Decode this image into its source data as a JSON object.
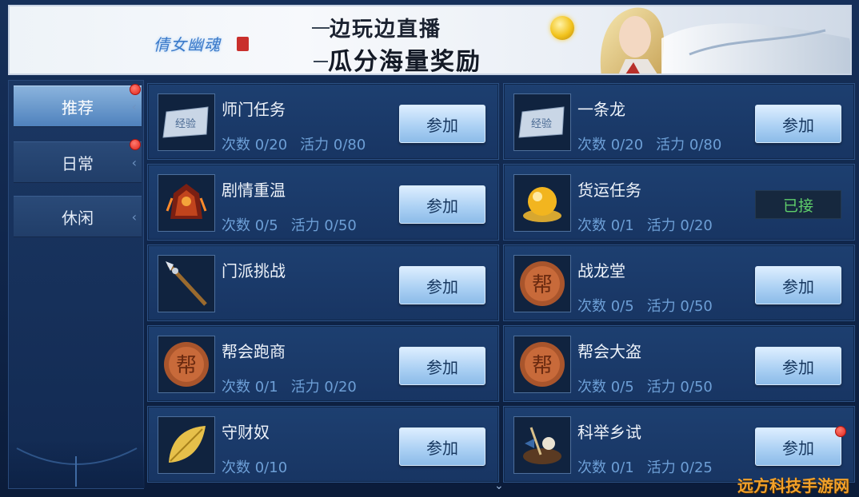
{
  "banner": {
    "logo": "倩女幽魂",
    "logo_sub": "手游",
    "title": "边玩边直播",
    "subtitle": "瓜分海量奖励"
  },
  "sidebar": {
    "tabs": [
      {
        "label": "推荐",
        "active": true,
        "badge": true
      },
      {
        "label": "日常",
        "active": false,
        "badge": true
      },
      {
        "label": "休闲",
        "active": false,
        "badge": false
      }
    ]
  },
  "activities": [
    {
      "name": "师门任务",
      "count": "次数 0/20",
      "vitality": "活力 0/80",
      "action": "参加",
      "icon": "exp-scroll-icon"
    },
    {
      "name": "一条龙",
      "count": "次数 0/20",
      "vitality": "活力 0/80",
      "action": "参加",
      "icon": "exp-scroll-icon"
    },
    {
      "name": "剧情重温",
      "count": "次数 0/5",
      "vitality": "活力 0/50",
      "action": "参加",
      "icon": "flame-helmet-icon"
    },
    {
      "name": "货运任务",
      "count": "次数 0/1",
      "vitality": "活力 0/20",
      "action": "已接",
      "icon": "golden-orb-icon"
    },
    {
      "name": "门派挑战",
      "count": "",
      "vitality": "",
      "action": "参加",
      "icon": "spear-icon"
    },
    {
      "name": "战龙堂",
      "count": "次数 0/5",
      "vitality": "活力 0/50",
      "action": "参加",
      "icon": "guild-coin-icon"
    },
    {
      "name": "帮会跑商",
      "count": "次数 0/1",
      "vitality": "活力 0/20",
      "action": "参加",
      "icon": "guild-coin-icon"
    },
    {
      "name": "帮会大盗",
      "count": "次数 0/5",
      "vitality": "活力 0/50",
      "action": "参加",
      "icon": "guild-coin-icon"
    },
    {
      "name": "守财奴",
      "count": "次数 0/10",
      "vitality": "",
      "action": "参加",
      "icon": "golden-leaf-icon"
    },
    {
      "name": "科举乡试",
      "count": "次数 0/1",
      "vitality": "活力 0/25",
      "action": "参加",
      "icon": "scholar-icon",
      "badge": true
    }
  ],
  "icon_texts": {
    "exp": "经验",
    "guild": "帮"
  },
  "scroll_hint": "⌄",
  "watermark": "远方科技手游网",
  "colors": {
    "accent": "#a9cff3",
    "accepted": "#5fcf6b",
    "badge": "#e0241b",
    "stat_text": "#6d9fd6"
  }
}
